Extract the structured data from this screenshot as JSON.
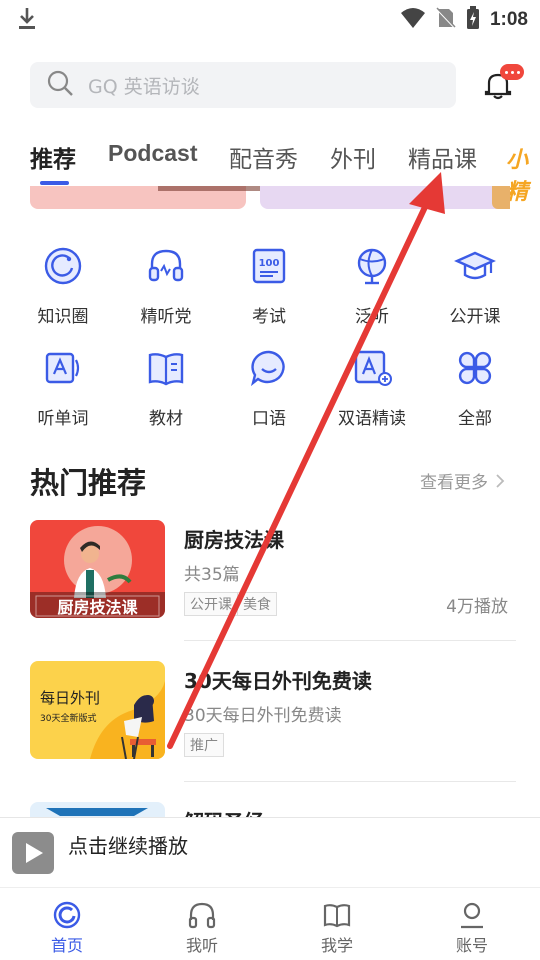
{
  "status_bar": {
    "time": "1:08"
  },
  "search": {
    "placeholder": "GQ 英语访谈"
  },
  "tabs": [
    {
      "label": "推荐",
      "active": true
    },
    {
      "label": "Podcast"
    },
    {
      "label": "配音秀"
    },
    {
      "label": "外刊"
    },
    {
      "label": "精品课"
    }
  ],
  "tab_extra": "小精",
  "grid": [
    {
      "label": "知识圈",
      "icon": "circle-refresh-icon"
    },
    {
      "label": "精听党",
      "icon": "headset-icon"
    },
    {
      "label": "考试",
      "icon": "exam-100-icon"
    },
    {
      "label": "泛听",
      "icon": "globe-icon"
    },
    {
      "label": "公开课",
      "icon": "graduation-cap-icon"
    },
    {
      "label": "听单词",
      "icon": "word-card-icon"
    },
    {
      "label": "教材",
      "icon": "book-icon"
    },
    {
      "label": "口语",
      "icon": "speech-bubble-icon"
    },
    {
      "label": "双语精读",
      "icon": "bilingual-icon"
    },
    {
      "label": "全部",
      "icon": "grid-all-icon"
    }
  ],
  "hot": {
    "title": "热门推荐",
    "more": "查看更多",
    "items": [
      {
        "title": "厨房技法课",
        "sub": "共35篇",
        "tags": [
          "公开课",
          "美食"
        ],
        "plays": "4万播放",
        "thumb_text": "厨房技法课"
      },
      {
        "title": "30天每日外刊免费读",
        "sub": "30天每日外刊免费读",
        "tags": [
          "推广"
        ],
        "plays": "",
        "thumb_text": "每日外刊",
        "thumb_sub": "30天全新版式"
      },
      {
        "title": "解码圣经",
        "sub": "",
        "tags": [],
        "plays": ""
      }
    ]
  },
  "player": {
    "text": "点击继续播放"
  },
  "bottom_nav": [
    {
      "label": "首页",
      "active": true
    },
    {
      "label": "我听"
    },
    {
      "label": "我学"
    },
    {
      "label": "账号"
    }
  ],
  "colors": {
    "accent": "#3b5be6",
    "annotation": "#e53935"
  }
}
